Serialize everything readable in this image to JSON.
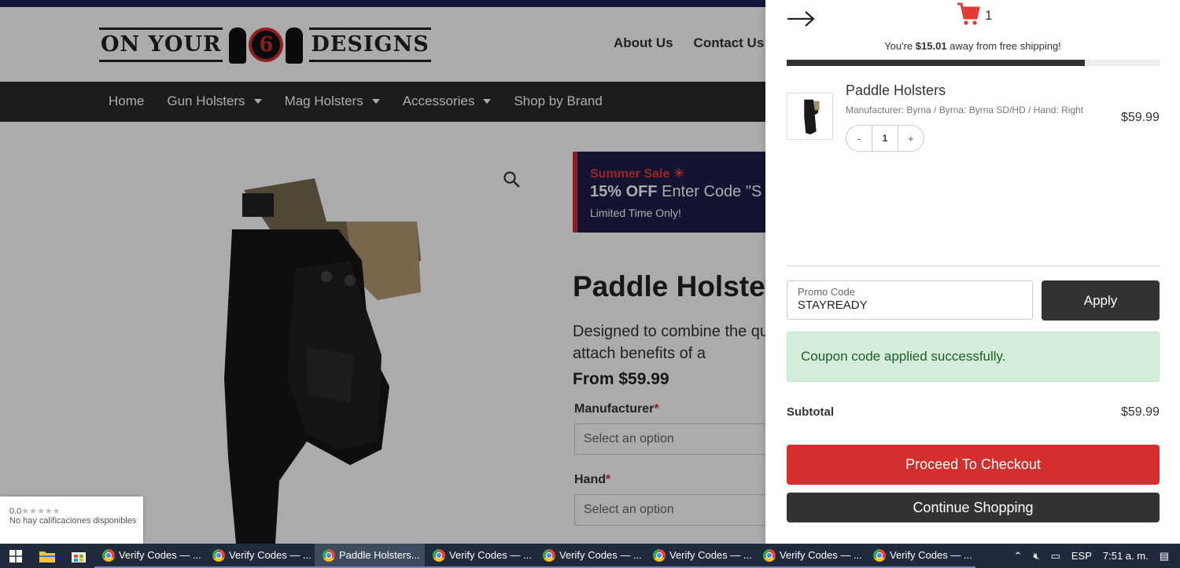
{
  "site": {
    "logo_left": "ON YOUR",
    "logo_num": "6",
    "logo_right": "DESIGNS",
    "top_links": [
      "About Us",
      "Contact Us"
    ],
    "nav": [
      {
        "label": "Home",
        "dropdown": false
      },
      {
        "label": "Gun Holsters",
        "dropdown": true
      },
      {
        "label": "Mag Holsters",
        "dropdown": true
      },
      {
        "label": "Accessories",
        "dropdown": true
      },
      {
        "label": "Shop by Brand",
        "dropdown": false
      }
    ]
  },
  "product": {
    "banner_line1": "Summer Sale ☀",
    "banner_bold": "15% OFF",
    "banner_rest": " Enter Code \"S",
    "banner_line3": "Limited Time Only!",
    "title": "Paddle Holsters",
    "description": "Designed to combine the quick-attach benefits of a",
    "price": "From $59.99",
    "manufacturer_label": "Manufacturer",
    "manufacturer_placeholder": "Select an option",
    "hand_label": "Hand",
    "hand_placeholder": "Select an option",
    "required_mark": "*"
  },
  "rating_badge": {
    "score": "0.0",
    "stars": "★★★★★",
    "text": "No hay calificaciones disponibles"
  },
  "cart": {
    "count": "1",
    "shipping_prefix": "You're ",
    "shipping_amount": "$15.01",
    "shipping_suffix": " away from free shipping!",
    "shipping_progress": 0.8,
    "item": {
      "name": "Paddle Holsters",
      "meta": "Manufacturer: Byrna / Byrna: Byrna SD/HD / Hand: Right",
      "price": "$59.99",
      "qty": "1",
      "minus": "-",
      "plus": "+"
    },
    "promo_label": "Promo Code",
    "promo_value": "STAYREADY",
    "apply_label": "Apply",
    "success_message": "Coupon code applied successfully.",
    "subtotal_label": "Subtotal",
    "subtotal_value": "$59.99",
    "checkout_label": "Proceed To Checkout",
    "continue_label": "Continue Shopping",
    "colors": {
      "checkout": "#d32f2f",
      "dark": "#333333",
      "success_bg": "#d4edda",
      "cart_icon": "#e53935"
    }
  },
  "taskbar": {
    "tasks": [
      {
        "label": "Verify Codes — ...",
        "active": false
      },
      {
        "label": "Verify Codes — ...",
        "active": false
      },
      {
        "label": "Paddle Holsters...",
        "active": true
      },
      {
        "label": "Verify Codes — ...",
        "active": false
      },
      {
        "label": "Verify Codes — ...",
        "active": false
      },
      {
        "label": "Verify Codes — ...",
        "active": false
      },
      {
        "label": "Verify Codes — ...",
        "active": false
      },
      {
        "label": "Verify Codes — ...",
        "active": false
      }
    ],
    "language": "ESP",
    "time": "7:51 a. m."
  }
}
